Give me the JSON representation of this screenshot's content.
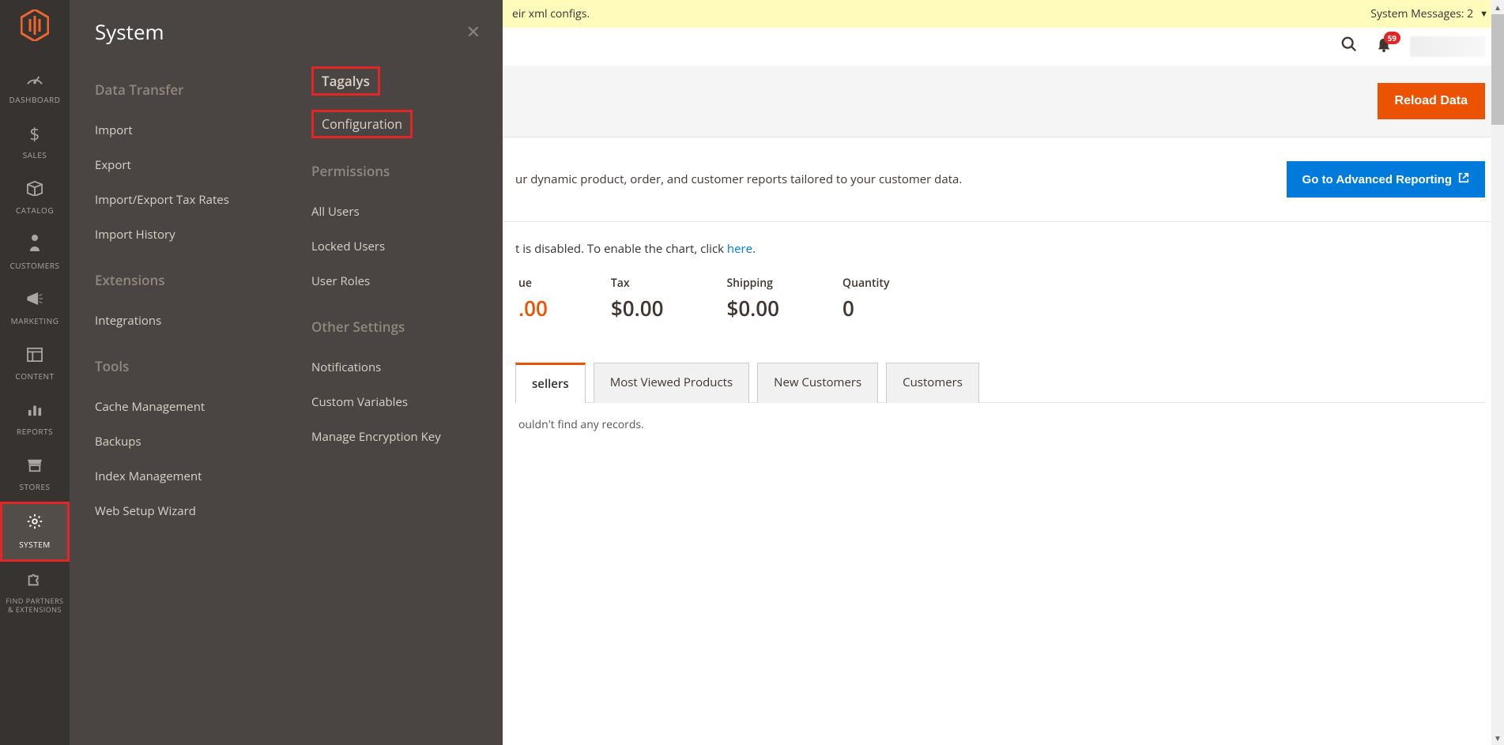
{
  "nav": {
    "items": [
      {
        "label": "DASHBOARD"
      },
      {
        "label": "SALES"
      },
      {
        "label": "CATALOG"
      },
      {
        "label": "CUSTOMERS"
      },
      {
        "label": "MARKETING"
      },
      {
        "label": "CONTENT"
      },
      {
        "label": "REPORTS"
      },
      {
        "label": "STORES"
      },
      {
        "label": "SYSTEM"
      },
      {
        "label": "FIND PARTNERS & EXTENSIONS"
      }
    ]
  },
  "flyout": {
    "title": "System",
    "col1": {
      "s1": {
        "head": "Data Transfer",
        "items": [
          "Import",
          "Export",
          "Import/Export Tax Rates",
          "Import History"
        ]
      },
      "s2": {
        "head": "Extensions",
        "items": [
          "Integrations"
        ]
      },
      "s3": {
        "head": "Tools",
        "items": [
          "Cache Management",
          "Backups",
          "Index Management",
          "Web Setup Wizard"
        ]
      }
    },
    "col2": {
      "highlight1": "Tagalys",
      "highlight2": "Configuration",
      "perm": {
        "head": "Permissions",
        "items": [
          "All Users",
          "Locked Users",
          "User Roles"
        ]
      },
      "other": {
        "head": "Other Settings",
        "items": [
          "Notifications",
          "Custom Variables",
          "Manage Encryption Key"
        ]
      }
    }
  },
  "sys_msg": {
    "left_partial": "eir xml configs.",
    "right_label": "System Messages: 2"
  },
  "toolbar": {
    "notif_count": "59"
  },
  "reload_label": "Reload Data",
  "adv": {
    "desc_partial": "ur dynamic product, order, and customer reports tailored to your customer data.",
    "btn": "Go to Advanced Reporting"
  },
  "chart_note": {
    "prefix": "t is disabled. To enable the chart, click ",
    "link": "here",
    "suffix": "."
  },
  "metrics": {
    "revenue": {
      "label": "ue",
      "value": ".00"
    },
    "tax": {
      "label": "Tax",
      "value": "$0.00"
    },
    "shipping": {
      "label": "Shipping",
      "value": "$0.00"
    },
    "quantity": {
      "label": "Quantity",
      "value": "0"
    }
  },
  "tabs": {
    "items": [
      "sellers",
      "Most Viewed Products",
      "New Customers",
      "Customers"
    ],
    "empty": "ouldn't find any records."
  }
}
